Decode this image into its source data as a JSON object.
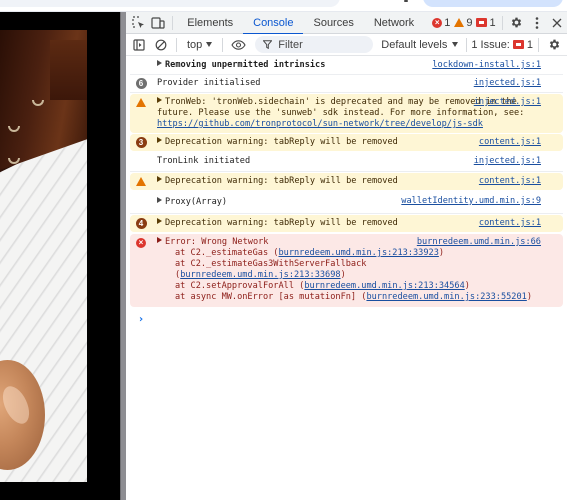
{
  "devtools": {
    "tabs": [
      {
        "label": "Elements",
        "active": false
      },
      {
        "label": "Console",
        "active": true
      },
      {
        "label": "Sources",
        "active": false
      },
      {
        "label": "Network",
        "active": false
      }
    ],
    "counters": {
      "errors": "1",
      "warnings": "9",
      "issues": "1"
    },
    "toolbar": {
      "context": "top",
      "filter_placeholder": "Filter",
      "levels": "Default levels",
      "issues_label": "1 Issue:",
      "issues_count": "1"
    },
    "colors": {
      "accent": "#0b57d0",
      "error": "#dc362e",
      "warning": "#e37400",
      "warn_bg": "#fef6d5",
      "error_bg": "#fce8e6",
      "link": "#1a4fa0"
    }
  },
  "console": {
    "messages": [
      {
        "type": "log",
        "expandable": true,
        "text": "Removing unpermitted intrinsics",
        "source": "lockdown-install.js:1"
      },
      {
        "type": "log",
        "repeat": "6",
        "text": "Provider initialised",
        "source": "injected.js:1"
      },
      {
        "type": "warning",
        "expandable": true,
        "text": "TronWeb: 'tronWeb.sidechain' is deprecated and may be removed in the future. Please use the 'sunweb' sdk instead. For more information, see:",
        "link": "https://github.com/tronprotocol/sun-network/tree/develop/js-sdk",
        "source": "injected.js:1"
      },
      {
        "type": "warning",
        "repeat": "3",
        "expandable": true,
        "text": "Deprecation warning: tabReply will be removed",
        "source": "content.js:1"
      },
      {
        "type": "log",
        "text": "TronLink initiated",
        "source": "injected.js:1"
      },
      {
        "type": "warning",
        "expandable": true,
        "text": "Deprecation warning: tabReply will be removed",
        "source": "content.js:1"
      },
      {
        "type": "log",
        "expandable": true,
        "text": "Proxy(Array)",
        "source": "walletIdentity.umd.min.js:9"
      },
      {
        "type": "warning",
        "repeat": "4",
        "expandable": true,
        "text": "Deprecation warning: tabReply will be removed",
        "source": "content.js:1"
      },
      {
        "type": "error",
        "expandable": true,
        "text": "Error: Wrong Network",
        "source": "burnredeem.umd.min.js:66",
        "stack": [
          {
            "prefix": "at C2._estimateGas (",
            "link": "burnredeem.umd.min.js:213:33923",
            "suffix": ")"
          },
          {
            "prefix": "at C2._estimateGas3WithServerFallback (",
            "link": "burnredeem.umd.min.js:213:33698",
            "suffix": ")"
          },
          {
            "prefix": "at C2.setApprovalForAll (",
            "link": "burnredeem.umd.min.js:213:34564",
            "suffix": ")"
          },
          {
            "prefix": "at async MW.onError [as mutationFn] (",
            "link": "burnredeem.umd.min.js:233:55201",
            "suffix": ")"
          }
        ]
      }
    ],
    "prompt_symbol": "›"
  }
}
